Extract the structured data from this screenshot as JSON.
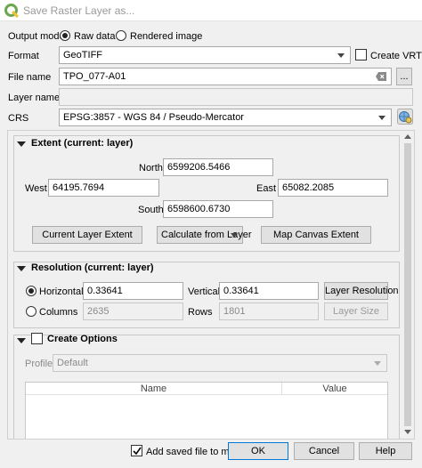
{
  "window": {
    "title": "Save Raster Layer as..."
  },
  "output_mode": {
    "label": "Output mode",
    "raw_label": "Raw data",
    "rendered_label": "Rendered image"
  },
  "format": {
    "label": "Format",
    "value": "GeoTIFF",
    "create_vrt_label": "Create VRT"
  },
  "file_name": {
    "label": "File name",
    "value": "TPO_077-A01",
    "browse_label": "..."
  },
  "layer_name": {
    "label": "Layer name",
    "value": ""
  },
  "crs": {
    "label": "CRS",
    "value": "EPSG:3857 - WGS 84 / Pseudo-Mercator"
  },
  "extent": {
    "title": "Extent (current: layer)",
    "north_label": "North",
    "north": "6599206.5466",
    "west_label": "West",
    "west": "64195.7694",
    "east_label": "East",
    "east": "65082.2085",
    "south_label": "South",
    "south": "6598600.6730",
    "current_layer_btn": "Current Layer Extent",
    "calc_from_layer": "Calculate from Layer",
    "map_canvas_btn": "Map Canvas Extent"
  },
  "resolution": {
    "title": "Resolution (current: layer)",
    "horizontal_label": "Horizontal",
    "horizontal": "0.33641",
    "vertical_label": "Vertical",
    "vertical": "0.33641",
    "layer_resolution_btn": "Layer Resolution",
    "columns_label": "Columns",
    "columns": "2635",
    "rows_label": "Rows",
    "rows": "1801",
    "layer_size_btn": "Layer Size"
  },
  "create_options": {
    "title": "Create Options",
    "profile_label": "Profile",
    "profile_value": "Default",
    "table_headers": [
      "Name",
      "Value"
    ]
  },
  "footer": {
    "add_to_map_label": "Add saved file to map",
    "ok": "OK",
    "cancel": "Cancel",
    "help": "Help"
  }
}
